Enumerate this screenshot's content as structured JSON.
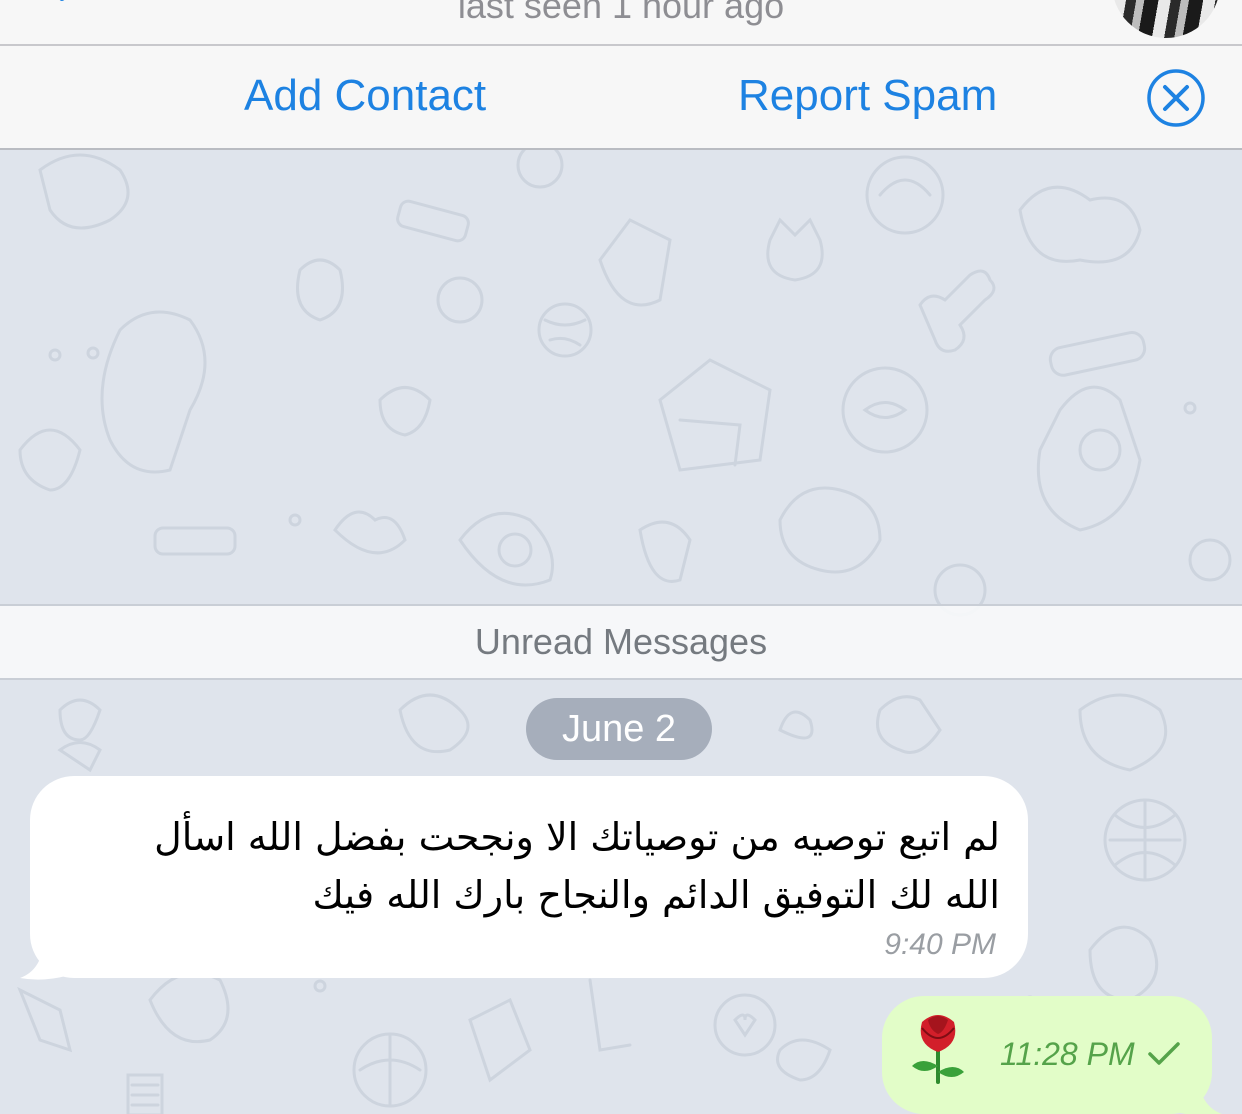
{
  "header": {
    "back_icon": "chevron-left-icon",
    "last_seen": "last seen 1 hour ago",
    "avatar_icon": "avatar"
  },
  "action_bar": {
    "add_contact": "Add Contact",
    "report_spam": "Report Spam",
    "close_icon": "close-circle-icon",
    "accent": "#1d82e2"
  },
  "chat": {
    "unread_label": "Unread Messages",
    "date_label": "June 2",
    "messages": [
      {
        "direction": "incoming",
        "lines": [
          "لم اتبع توصيه من توصياتك الا ونجحت بفضل الله اسأل",
          "الله لك التوفيق الدائم والنجاح بارك الله فيك"
        ],
        "time": "9:40 PM"
      },
      {
        "direction": "outgoing",
        "content_icon": "rose-emoji-icon",
        "time": "11:28 PM",
        "status_icon": "checkmark-icon"
      }
    ],
    "incoming_bubble_color": "#ffffff",
    "outgoing_bubble_color": "#e2fdc8"
  }
}
